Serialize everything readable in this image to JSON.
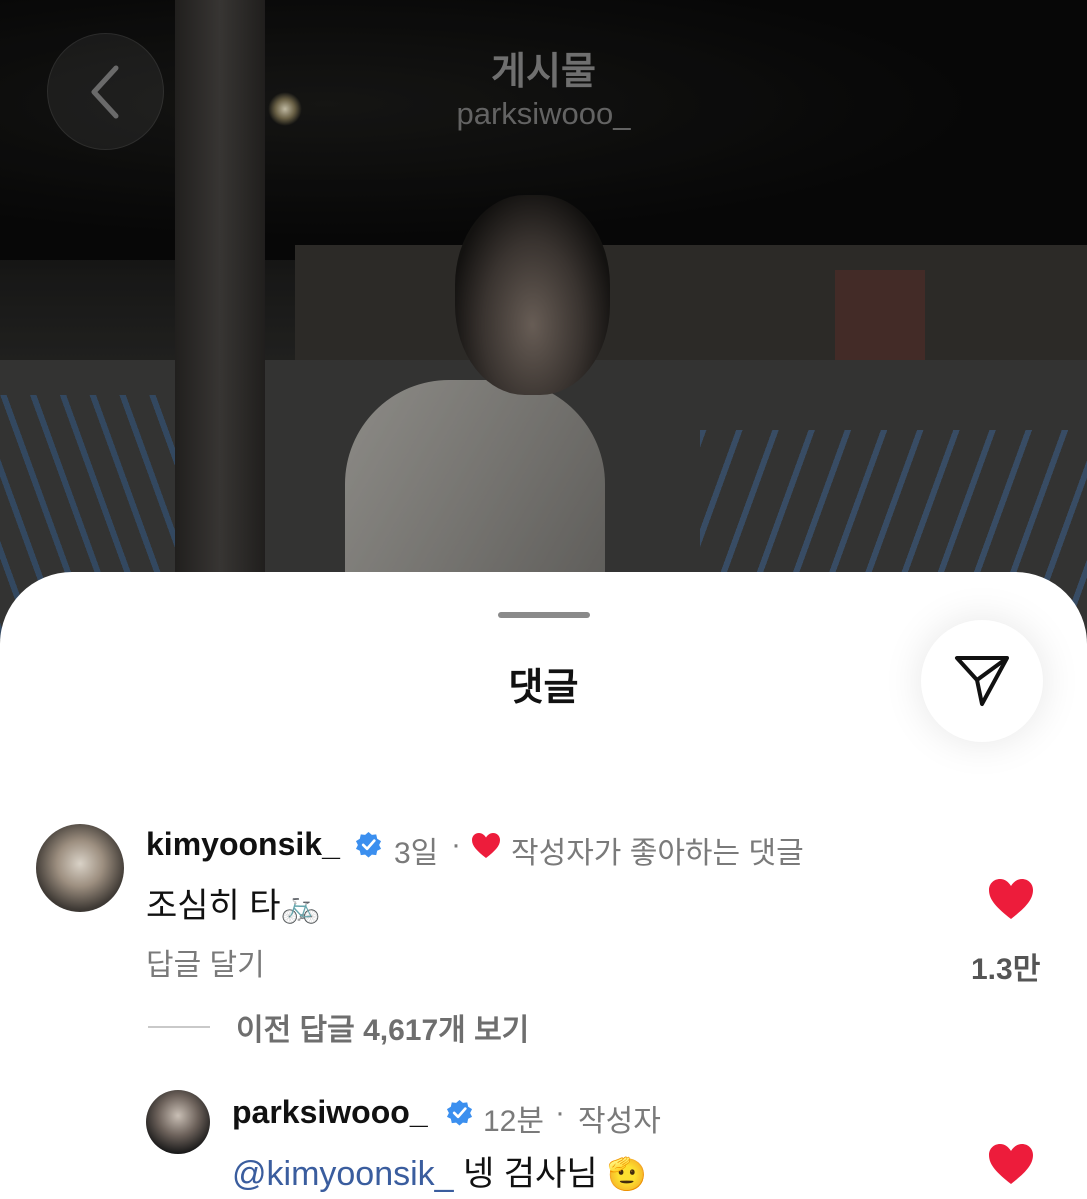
{
  "header": {
    "title": "게시물",
    "username": "parksiwooo_"
  },
  "sheet": {
    "title": "댓글"
  },
  "comments": [
    {
      "username": "kimyoonsik_",
      "time": "3일",
      "separator": "·",
      "liked_by_author": "작성자가 좋아하는 댓글",
      "text": "조심히 타",
      "emoji": "🚲",
      "reply_label": "답글 달기",
      "like_count": "1.3만",
      "view_replies": "이전 답글 4,617개 보기"
    },
    {
      "username": "parksiwooo_",
      "time": "12분",
      "separator": "·",
      "author_badge": "작성자",
      "mention": "@kimyoonsik_",
      "text": "넹 검사님",
      "emoji": "🫡"
    }
  ],
  "colors": {
    "heart": "#ed1c3b",
    "verified": "#3b8fef",
    "mention": "#3a5d9e"
  }
}
